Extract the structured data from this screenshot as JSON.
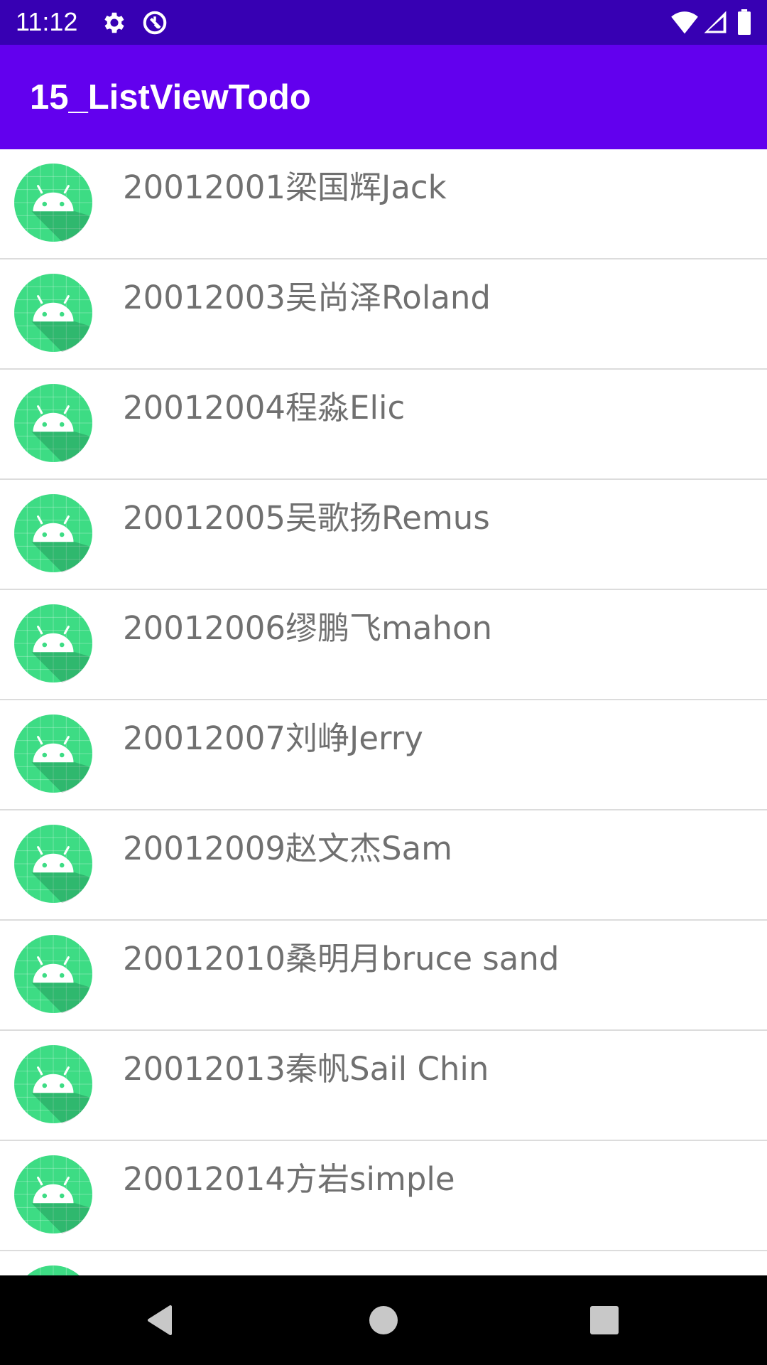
{
  "status_bar": {
    "time": "11:12",
    "icons": [
      "gear-icon",
      "data-saver-icon",
      "wifi-icon",
      "signal-icon",
      "battery-icon"
    ]
  },
  "app_bar": {
    "title": "15_ListViewTodo"
  },
  "list": {
    "items": [
      {
        "label": "20012001梁国辉Jack",
        "icon": "android-icon"
      },
      {
        "label": "20012003吴尚泽Roland",
        "icon": "android-icon"
      },
      {
        "label": "20012004程淼Elic",
        "icon": "android-icon"
      },
      {
        "label": "20012005吴歌扬Remus",
        "icon": "android-icon"
      },
      {
        "label": "20012006缪鹏飞mahon",
        "icon": "android-icon"
      },
      {
        "label": "20012007刘峥Jerry",
        "icon": "android-icon"
      },
      {
        "label": "20012009赵文杰Sam",
        "icon": "android-icon"
      },
      {
        "label": "20012010桑明月bruce sand",
        "icon": "android-icon"
      },
      {
        "label": "20012013秦帆Sail Chin",
        "icon": "android-icon"
      },
      {
        "label": "20012014方岩simple",
        "icon": "android-icon"
      }
    ]
  },
  "nav_bar": {
    "buttons": [
      "back-icon",
      "home-icon",
      "recents-icon"
    ]
  },
  "colors": {
    "status_bar": "#3700b3",
    "app_bar": "#6200ee",
    "avatar_green": "#3ddc84",
    "divider": "#dcdcdc",
    "item_text": "#707070"
  }
}
